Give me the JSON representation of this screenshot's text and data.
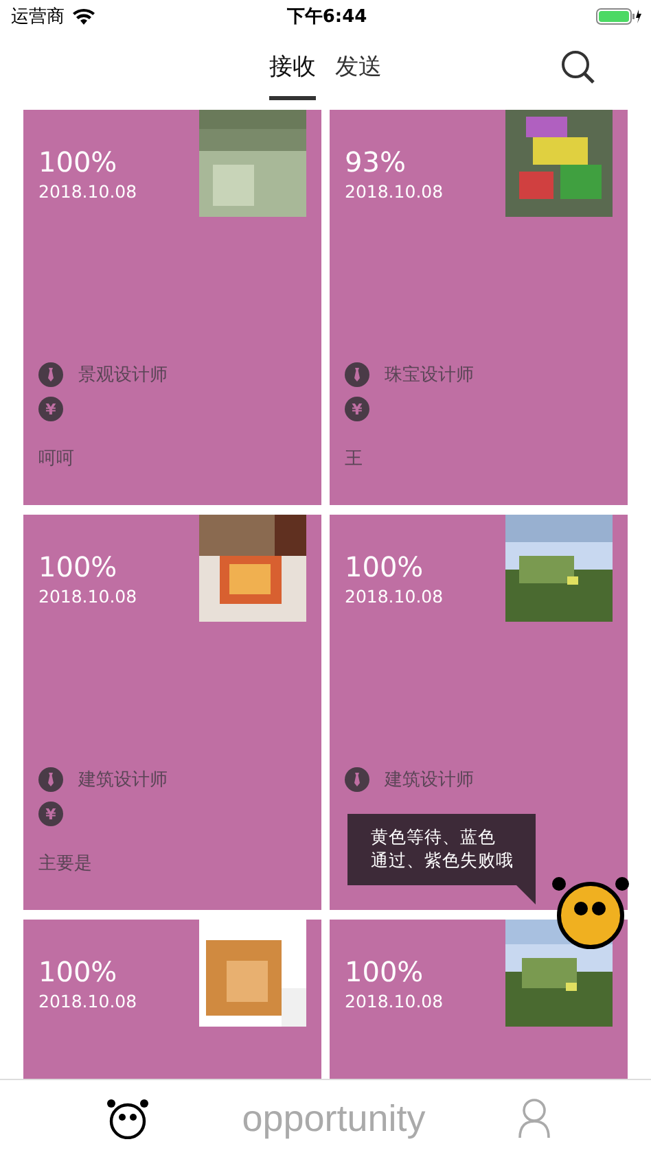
{
  "status_bar": {
    "carrier": "运营商",
    "time": "下午6:44"
  },
  "tabs": [
    {
      "label": "接收",
      "selected": true
    },
    {
      "label": "发送",
      "selected": false
    }
  ],
  "cards": [
    {
      "percent": "100%",
      "date": "2018.10.08",
      "job": "景观设计师",
      "currency": "¥",
      "note": "呵呵"
    },
    {
      "percent": "93%",
      "date": "2018.10.08",
      "job": "珠宝设计师",
      "currency": "¥",
      "note": "王"
    },
    {
      "percent": "100%",
      "date": "2018.10.08",
      "job": "建筑设计师",
      "currency": "¥",
      "note": "主要是"
    },
    {
      "percent": "100%",
      "date": "2018.10.08",
      "job": "建筑设计师"
    },
    {
      "percent": "100%",
      "date": "2018.10.08"
    },
    {
      "percent": "100%",
      "date": "2018.10.08"
    }
  ],
  "tooltip": {
    "lines": [
      "黄色等待、蓝色",
      "通过、紫色失败哦"
    ]
  },
  "bottom_tabs": [
    {
      "kind": "mascot",
      "selected": true
    },
    {
      "kind": "text",
      "label": "opportunity",
      "selected": false
    },
    {
      "kind": "person",
      "selected": false
    }
  ]
}
